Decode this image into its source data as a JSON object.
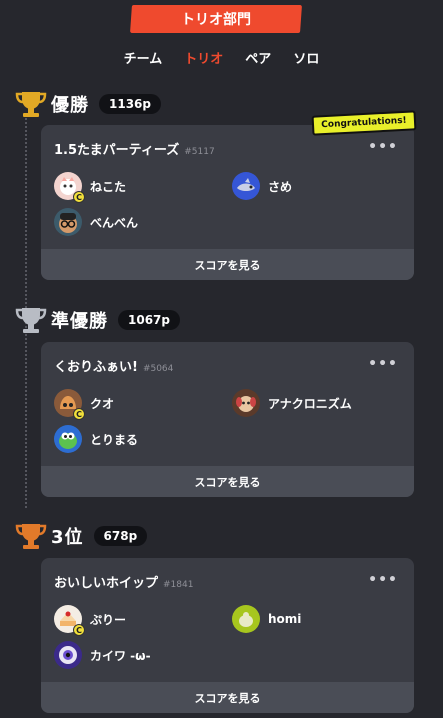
{
  "header": {
    "title": "トリオ部門"
  },
  "subtabs": [
    {
      "label": "チーム",
      "active": false
    },
    {
      "label": "トリオ",
      "active": true
    },
    {
      "label": "ペア",
      "active": false
    },
    {
      "label": "ソロ",
      "active": false
    }
  ],
  "colors": {
    "accent": "#ef4a2e",
    "gold": "#e2a925",
    "silver": "#b8bcc4",
    "bronze": "#e27a2a",
    "badge": "#e9f02a"
  },
  "places": [
    {
      "title": "優勝",
      "points": "1136p",
      "trophy": "gold-trophy-icon",
      "badge": "Congratulations!",
      "team": {
        "name": "1.5たまパーティーズ",
        "id": "#5117"
      },
      "members": [
        {
          "name": "ねこた",
          "avatar": "cat-avatar",
          "captain": true
        },
        {
          "name": "さめ",
          "avatar": "shark-avatar",
          "captain": false
        },
        {
          "name": "べんべん",
          "avatar": "glasses-avatar",
          "captain": false
        }
      ],
      "score_label": "スコアを見る"
    },
    {
      "title": "準優勝",
      "points": "1067p",
      "trophy": "silver-trophy-icon",
      "team": {
        "name": "くおりふぁい!",
        "id": "#5064"
      },
      "members": [
        {
          "name": "クオ",
          "avatar": "squid-avatar",
          "captain": true
        },
        {
          "name": "アナクロニズム",
          "avatar": "puppy-avatar",
          "captain": false
        },
        {
          "name": "とりまる",
          "avatar": "yoshi-avatar",
          "captain": false
        }
      ],
      "score_label": "スコアを見る"
    },
    {
      "title": "3位",
      "points": "678p",
      "trophy": "bronze-trophy-icon",
      "team": {
        "name": "おいしいホイップ",
        "id": "#1841"
      },
      "members": [
        {
          "name": "ぷりー",
          "avatar": "cake-avatar",
          "captain": true
        },
        {
          "name": "homi",
          "avatar": "blob-avatar",
          "captain": false
        },
        {
          "name": "カイワ -ω-",
          "avatar": "eye-avatar",
          "captain": false
        }
      ],
      "score_label": "スコアを見る"
    }
  ],
  "captain_mark": "C"
}
